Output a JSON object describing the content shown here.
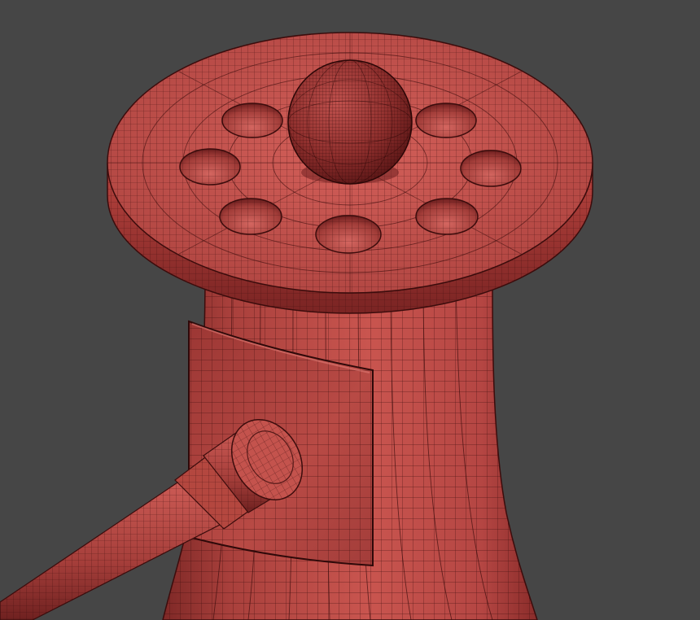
{
  "scene": {
    "subject": "wireframe-mesh-jack",
    "colors": {
      "background": "#464646",
      "base": "#b7403f",
      "highlight": "#d5605b",
      "shadow": "#6e1f1f",
      "wire": "#3b0c0c"
    }
  }
}
